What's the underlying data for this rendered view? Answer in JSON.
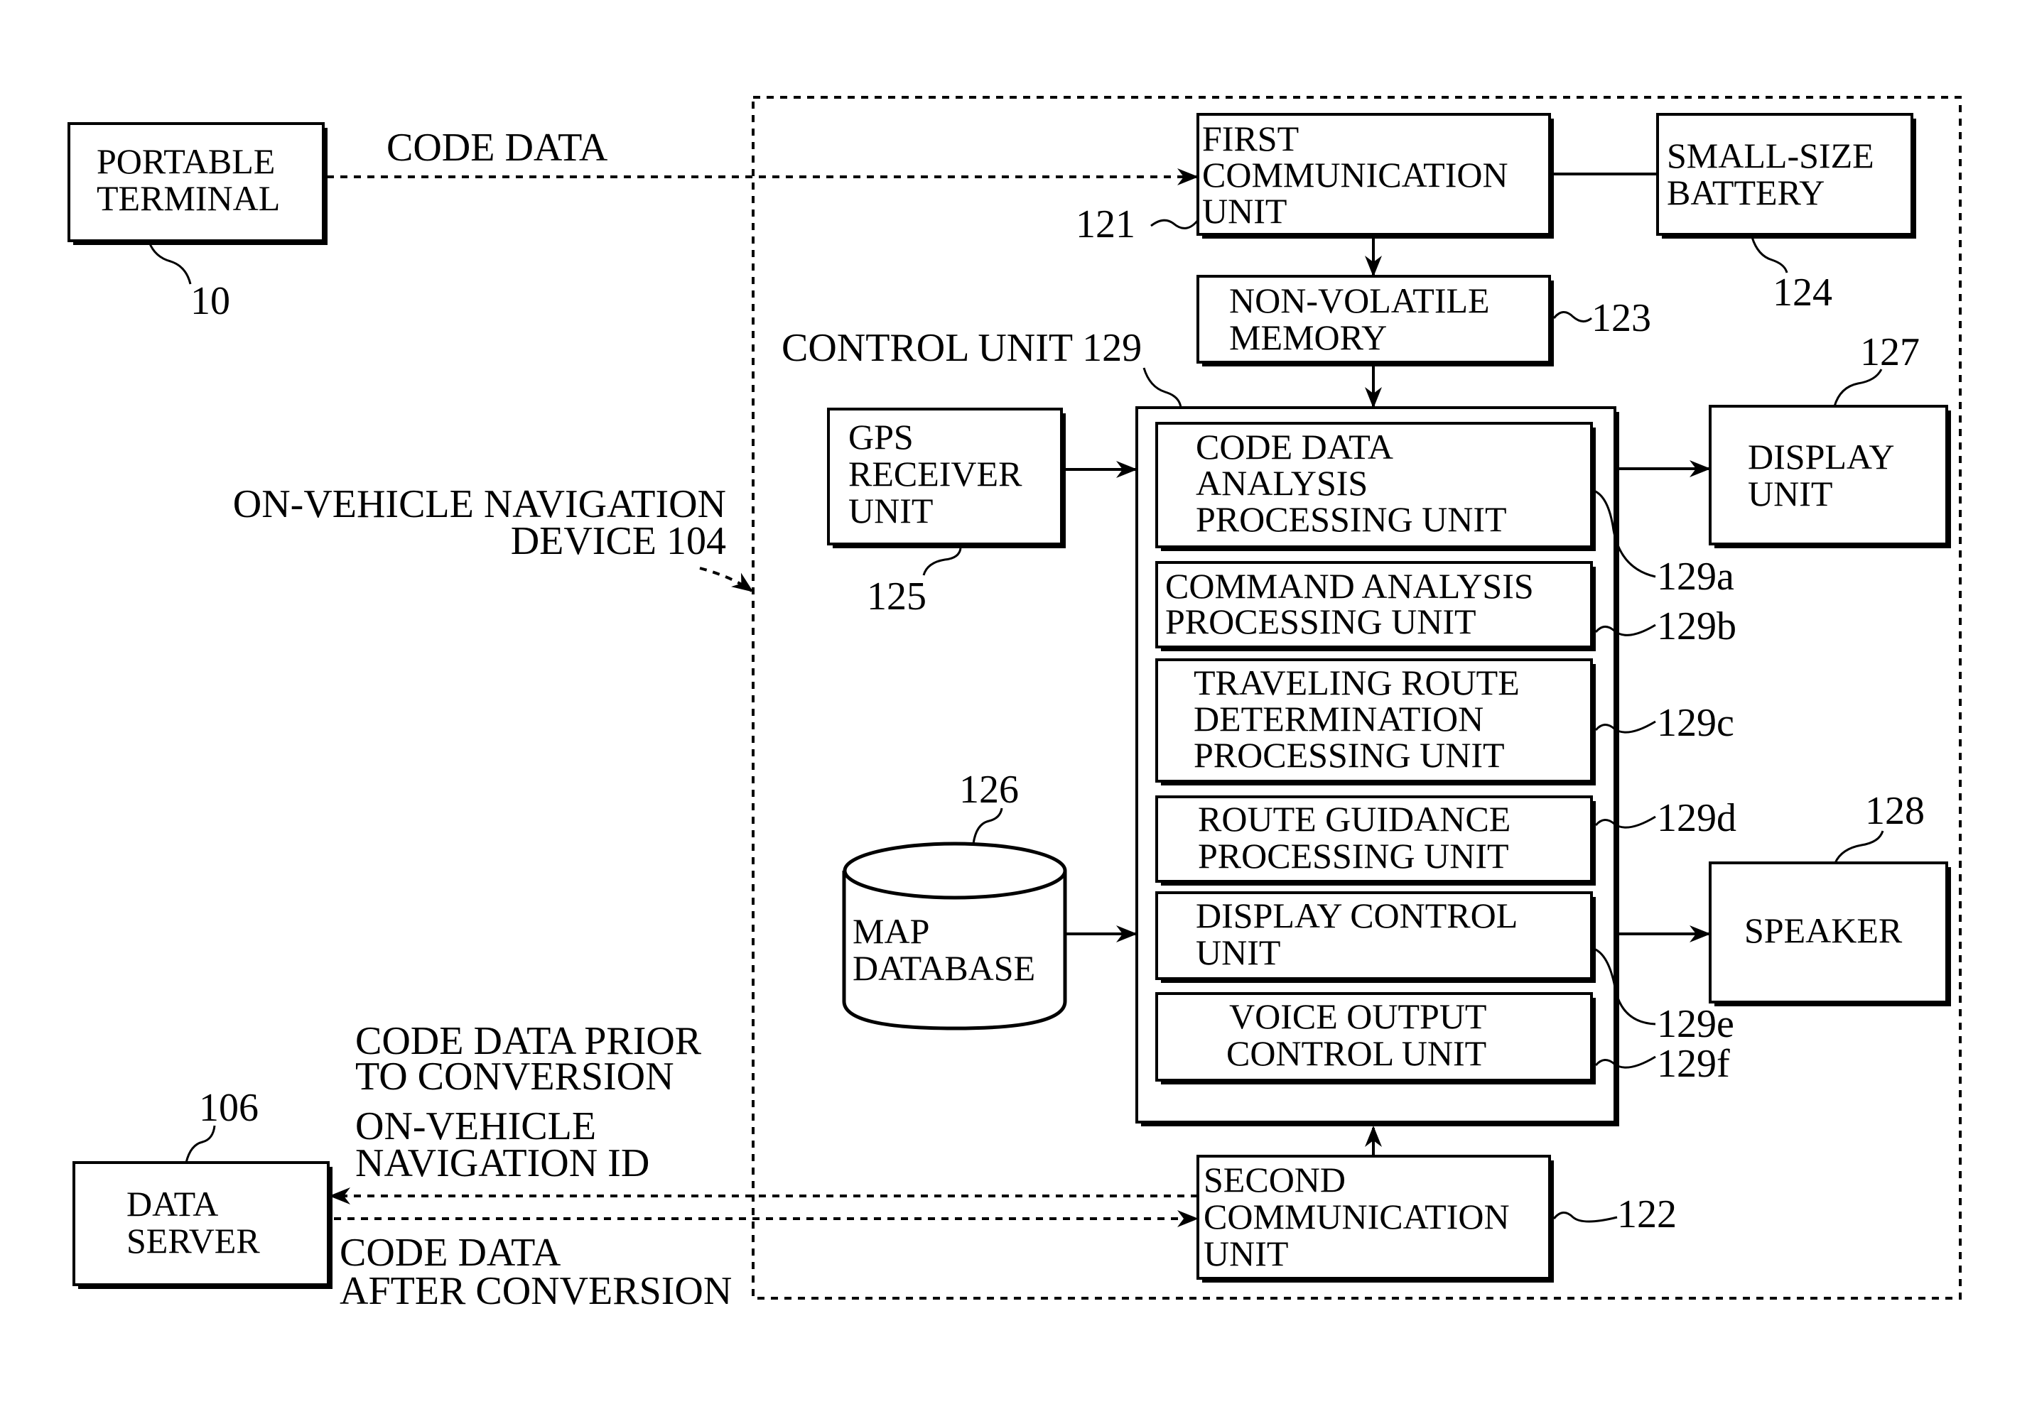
{
  "figure": {
    "outer_device": {
      "label_line1": "ON-VEHICLE NAVIGATION",
      "label_line2": "DEVICE 104"
    },
    "blocks": {
      "portable_terminal": {
        "lines": [
          "PORTABLE",
          "TERMINAL"
        ],
        "ref": "10"
      },
      "first_comm": {
        "lines": [
          "FIRST",
          "COMMUNICATION",
          "UNIT"
        ],
        "ref": "121"
      },
      "battery": {
        "lines": [
          "SMALL-SIZE",
          "BATTERY"
        ],
        "ref": "124"
      },
      "memory": {
        "lines": [
          "NON-VOLATILE",
          "MEMORY"
        ],
        "ref": "123"
      },
      "gps": {
        "lines": [
          "GPS",
          "RECEIVER",
          "UNIT"
        ],
        "ref": "125"
      },
      "control_unit": {
        "label": "CONTROL UNIT 129"
      },
      "display_unit": {
        "lines": [
          "DISPLAY",
          "UNIT"
        ],
        "ref": "127"
      },
      "speaker": {
        "lines": [
          "SPEAKER"
        ],
        "ref": "128"
      },
      "map_db": {
        "lines": [
          "MAP",
          "DATABASE"
        ],
        "ref": "126"
      },
      "second_comm": {
        "lines": [
          "SECOND",
          "COMMUNICATION",
          "UNIT"
        ],
        "ref": "122"
      },
      "data_server": {
        "lines": [
          "DATA",
          "SERVER"
        ],
        "ref": "106"
      }
    },
    "sub_units": [
      {
        "lines": [
          "CODE DATA",
          "ANALYSIS",
          "PROCESSING UNIT"
        ],
        "ref": "129a"
      },
      {
        "lines": [
          "COMMAND ANALYSIS",
          "PROCESSING UNIT"
        ],
        "ref": "129b"
      },
      {
        "lines": [
          "TRAVELING ROUTE",
          "DETERMINATION",
          "PROCESSING UNIT"
        ],
        "ref": "129c"
      },
      {
        "lines": [
          "ROUTE GUIDANCE",
          "PROCESSING UNIT"
        ],
        "ref": "129d"
      },
      {
        "lines": [
          "DISPLAY CONTROL",
          "UNIT"
        ],
        "ref": "129e"
      },
      {
        "lines": [
          "VOICE OUTPUT",
          "CONTROL UNIT"
        ],
        "ref": "129f"
      }
    ],
    "flow_labels": {
      "code_data": "CODE DATA",
      "prior_line1": "CODE DATA PRIOR",
      "prior_line2": "TO CONVERSION",
      "nav_id_line1": "ON-VEHICLE",
      "nav_id_line2": "NAVIGATION ID",
      "after_line1": "CODE DATA",
      "after_line2": "AFTER CONVERSION"
    }
  }
}
